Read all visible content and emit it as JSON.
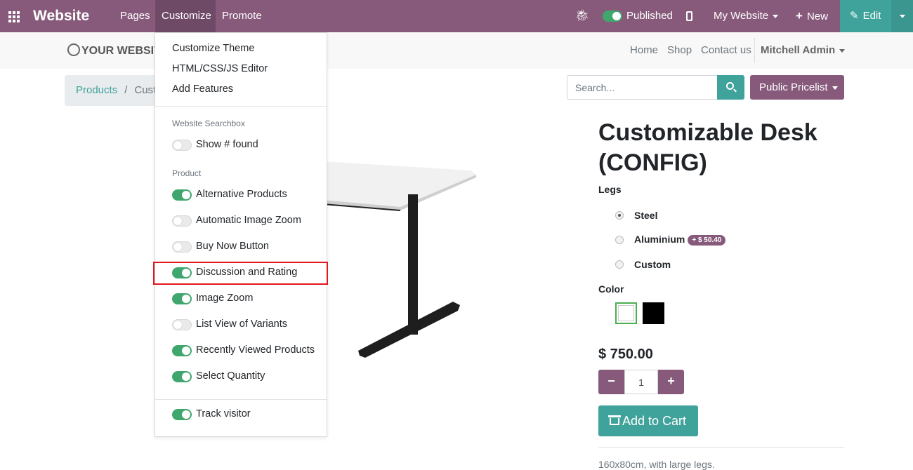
{
  "topbar": {
    "brand": "Website",
    "menus": {
      "pages": "Pages",
      "customize": "Customize",
      "promote": "Promote"
    },
    "published_label": "Published",
    "published_on": true,
    "website_label": "My Website",
    "new_label": "New",
    "edit_label": "Edit",
    "bar_color": "#875a7b",
    "edit_color": "#3fa29b"
  },
  "site": {
    "logo_text": "YOUR WEBSITE",
    "nav": {
      "home": "Home",
      "shop": "Shop",
      "contact": "Contact us",
      "user": "Mitchell Admin"
    }
  },
  "breadcrumb": {
    "root": "Products",
    "sep": "/",
    "current": "Customizable Desk (CONFIG)"
  },
  "search": {
    "placeholder": "Search..."
  },
  "pricelist": {
    "label": "Public Pricelist"
  },
  "product": {
    "title": "Customizable Desk (CONFIG)",
    "legs_label": "Legs",
    "legs_options": [
      {
        "label": "Steel",
        "checked": true
      },
      {
        "label": "Aluminium",
        "extra": "+ $ 50.40",
        "checked": false
      },
      {
        "label": "Custom",
        "checked": false
      }
    ],
    "color_label": "Color",
    "colors": [
      "#ffffff",
      "#000000"
    ],
    "price": "$ 750.00",
    "quantity": "1",
    "qty_minus": "−",
    "qty_plus": "+",
    "add_to_cart": "Add to Cart",
    "description": "160x80cm, with large legs."
  },
  "customize_menu": {
    "items": [
      "Customize Theme",
      "HTML/CSS/JS Editor",
      "Add Features"
    ],
    "searchbox_header": "Website Searchbox",
    "searchbox_options": [
      {
        "label": "Show # found",
        "on": false
      }
    ],
    "product_header": "Product",
    "product_options": [
      {
        "label": "Alternative Products",
        "on": true
      },
      {
        "label": "Automatic Image Zoom",
        "on": false
      },
      {
        "label": "Buy Now Button",
        "on": false
      },
      {
        "label": "Discussion and Rating",
        "on": true
      },
      {
        "label": "Image Zoom",
        "on": true
      },
      {
        "label": "List View of Variants",
        "on": false
      },
      {
        "label": "Recently Viewed Products",
        "on": true
      },
      {
        "label": "Select Quantity",
        "on": true
      }
    ],
    "tracking_options": [
      {
        "label": "Track visitor",
        "on": true
      }
    ]
  }
}
